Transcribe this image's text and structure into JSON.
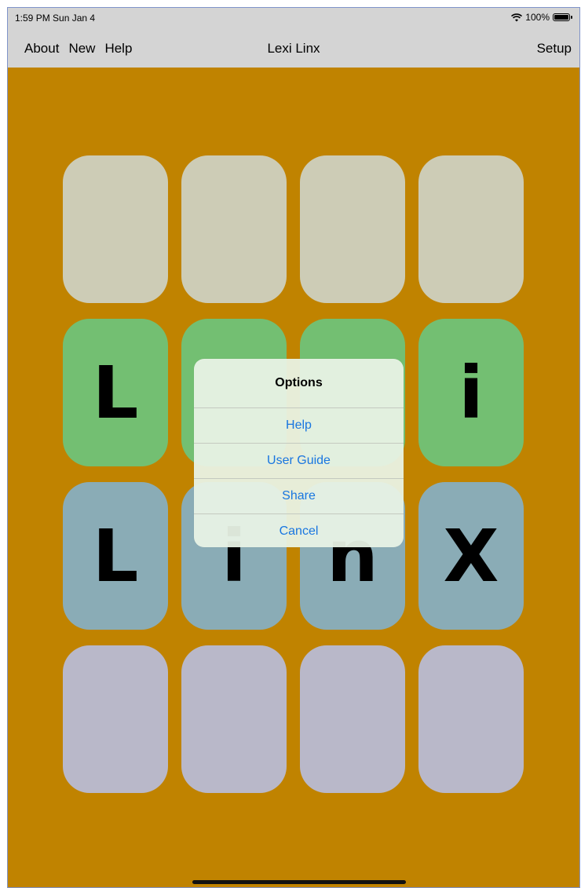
{
  "status_bar": {
    "time": "1:59 PM  Sun Jan 4",
    "battery": "100%"
  },
  "nav_bar": {
    "about": "About",
    "new": "New",
    "help": "Help",
    "title": "Lexi Linx",
    "setup": "Setup"
  },
  "board": {
    "rows": [
      {
        "color": "beige",
        "tiles": [
          "",
          "",
          "",
          ""
        ]
      },
      {
        "color": "green",
        "tiles": [
          "L",
          "",
          "",
          "i"
        ]
      },
      {
        "color": "blue",
        "tiles": [
          "L",
          "i",
          "n",
          "X"
        ]
      },
      {
        "color": "lavender",
        "tiles": [
          "",
          "",
          "",
          ""
        ]
      }
    ]
  },
  "dialog": {
    "title": "Options",
    "help": "Help",
    "user_guide": "User Guide",
    "share": "Share",
    "cancel": "Cancel"
  },
  "colors": {
    "background": "#c08300",
    "beige": "#cdccb6",
    "green": "#73bf72",
    "blue": "#8aacb6",
    "lavender": "#b9b8c9",
    "link": "#1976e0"
  }
}
